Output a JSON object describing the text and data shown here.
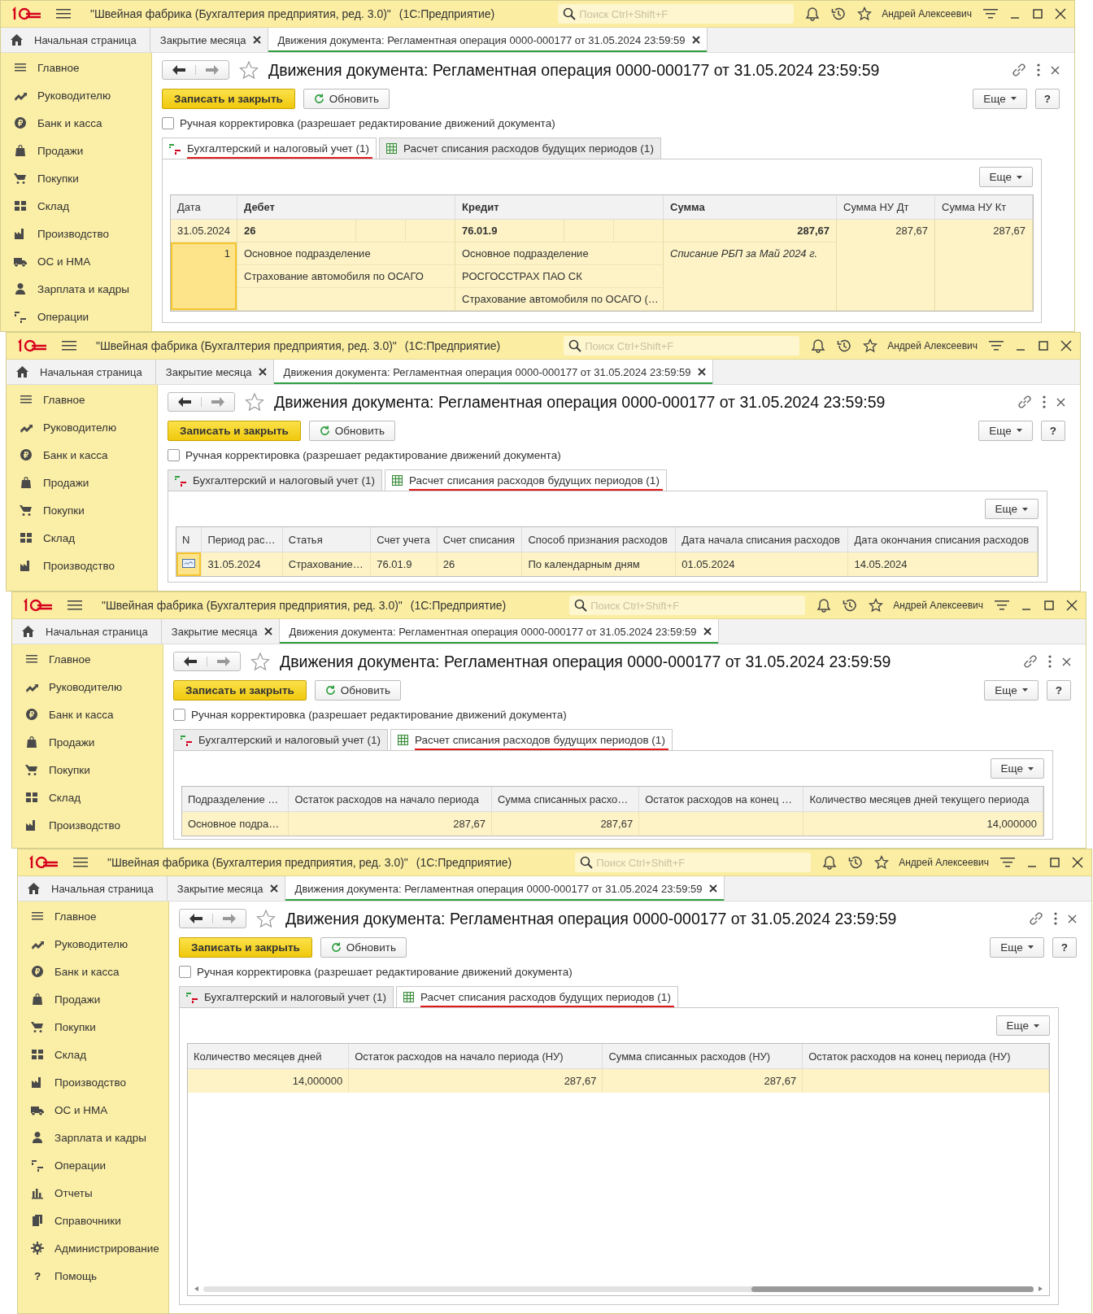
{
  "windows": [
    {
      "title": "\"Швейная фабрика (Бухгалтерия предприятия, ред. 3.0)\"",
      "app": "(1С:Предприятие)",
      "search_placeholder": "Поиск Ctrl+Shift+F",
      "user": "Андрей Алексеевич",
      "tabs": [
        {
          "label": "Начальная страница",
          "closable": false,
          "selected": false
        },
        {
          "label": "Закрытие месяца",
          "closable": true,
          "selected": false
        },
        {
          "label": "Движения документа: Регламентная операция 0000-000177 от 31.05.2024 23:59:59",
          "closable": true,
          "selected": true
        }
      ],
      "sidebar": [
        {
          "label": "Главное"
        },
        {
          "label": "Руководителю"
        },
        {
          "label": "Банк и касса"
        },
        {
          "label": "Продажи"
        },
        {
          "label": "Покупки"
        },
        {
          "label": "Склад"
        },
        {
          "label": "Производство"
        },
        {
          "label": "ОС и НМА"
        },
        {
          "label": "Зарплата и кадры"
        },
        {
          "label": "Операции"
        }
      ],
      "form": {
        "title": "Движения документа: Регламентная операция 0000-000177 от 31.05.2024 23:59:59",
        "save": "Записать и закрыть",
        "refresh": "Обновить",
        "more": "Еще",
        "help": "?",
        "manual": {
          "label": "Ручная корректировка (разрешает редактирование движений документа)",
          "checked": false
        },
        "tabs": [
          {
            "label": "Бухгалтерский и налоговый учет (1)",
            "selected": true
          },
          {
            "label": "Расчет списания расходов будущих периодов (1)",
            "selected": false
          }
        ],
        "panel_more": "Еще",
        "table": {
          "kind": "entries",
          "columns": [
            "Дата",
            "Дебет",
            "Кредит",
            "Сумма",
            "Сумма НУ Дт",
            "Сумма НУ Кт"
          ],
          "rows": [
            {
              "selected": true,
              "date": "31.05.2024",
              "number": "1",
              "debit": [
                "26",
                "Основное подразделение",
                "Страхование автомобиля по ОСАГО"
              ],
              "credit": [
                "76.01.9",
                "Основное подразделение",
                "РОСГОССТРАХ ПАО СК",
                "Страхование автомобиля по ОСАГО (…"
              ],
              "sum": "287,67",
              "content": "Списание РБП за Май 2024 г.",
              "sum_nu_dt": "287,67",
              "sum_nu_kt": "287,67"
            }
          ]
        }
      }
    },
    {
      "title": "\"Швейная фабрика (Бухгалтерия предприятия, ред. 3.0)\"",
      "app": "(1С:Предприятие)",
      "search_placeholder": "Поиск Ctrl+Shift+F",
      "user": "Андрей Алексеевич",
      "tabs": [
        {
          "label": "Начальная страница",
          "closable": false,
          "selected": false
        },
        {
          "label": "Закрытие месяца",
          "closable": true,
          "selected": false
        },
        {
          "label": "Движения документа: Регламентная операция 0000-000177 от 31.05.2024 23:59:59",
          "closable": true,
          "selected": true
        }
      ],
      "sidebar": [
        {
          "label": "Главное"
        },
        {
          "label": "Руководителю"
        },
        {
          "label": "Банк и касса"
        },
        {
          "label": "Продажи"
        },
        {
          "label": "Покупки"
        },
        {
          "label": "Склад"
        },
        {
          "label": "Производство"
        }
      ],
      "form": {
        "title": "Движения документа: Регламентная операция 0000-000177 от 31.05.2024 23:59:59",
        "save": "Записать и закрыть",
        "refresh": "Обновить",
        "more": "Еще",
        "help": "?",
        "manual": {
          "label": "Ручная корректировка (разрешает редактирование движений документа)",
          "checked": false
        },
        "tabs": [
          {
            "label": "Бухгалтерский и налоговый учет (1)",
            "selected": false
          },
          {
            "label": "Расчет списания расходов будущих периодов (1)",
            "selected": true
          }
        ],
        "panel_more": "Еще",
        "table": {
          "kind": "grid",
          "columns": [
            {
              "label": "N"
            },
            {
              "label": "Период рас…",
              "right_aligned": false
            },
            {
              "label": "Статья",
              "right_aligned": false
            },
            {
              "label": "Счет учета",
              "right_aligned": false
            },
            {
              "label": "Счет списания",
              "right_aligned": false
            },
            {
              "label": "Способ признания расходов",
              "right_aligned": false
            },
            {
              "label": "Дата начала списания расходов",
              "right_aligned": false
            },
            {
              "label": "Дата окончания списания расходов",
              "right_aligned": false
            }
          ],
          "rows": [
            {
              "selected": true,
              "cells": [
                {
                  "kind": "icon"
                },
                {
                  "text": "31.05.2024"
                },
                {
                  "text": "Страхование…"
                },
                {
                  "text": "76.01.9"
                },
                {
                  "text": "26"
                },
                {
                  "text": "По календарным дням"
                },
                {
                  "text": "01.05.2024"
                },
                {
                  "text": "14.05.2024"
                }
              ]
            }
          ]
        }
      }
    },
    {
      "title": "\"Швейная фабрика (Бухгалтерия предприятия, ред. 3.0)\"",
      "app": "(1С:Предприятие)",
      "search_placeholder": "Поиск Ctrl+Shift+F",
      "user": "Андрей Алексеевич",
      "tabs": [
        {
          "label": "Начальная страница",
          "closable": false,
          "selected": false
        },
        {
          "label": "Закрытие месяца",
          "closable": true,
          "selected": false
        },
        {
          "label": "Движения документа: Регламентная операция 0000-000177 от 31.05.2024 23:59:59",
          "closable": true,
          "selected": true
        }
      ],
      "sidebar": [
        {
          "label": "Главное"
        },
        {
          "label": "Руководителю"
        },
        {
          "label": "Банк и касса"
        },
        {
          "label": "Продажи"
        },
        {
          "label": "Покупки"
        },
        {
          "label": "Склад"
        },
        {
          "label": "Производство"
        }
      ],
      "form": {
        "title": "Движения документа: Регламентная операция 0000-000177 от 31.05.2024 23:59:59",
        "save": "Записать и закрыть",
        "refresh": "Обновить",
        "more": "Еще",
        "help": "?",
        "manual": {
          "label": "Ручная корректировка (разрешает редактирование движений документа)",
          "checked": false
        },
        "tabs": [
          {
            "label": "Бухгалтерский и налоговый учет (1)",
            "selected": false
          },
          {
            "label": "Расчет списания расходов будущих периодов (1)",
            "selected": true
          }
        ],
        "panel_more": "Еще",
        "table": {
          "kind": "grid",
          "columns": [
            {
              "label": "Подразделение …",
              "right_aligned": false
            },
            {
              "label": "Остаток расходов на начало периода",
              "right_aligned": true
            },
            {
              "label": "Сумма списанных расхо…",
              "right_aligned": true
            },
            {
              "label": "Остаток расходов на конец …"
            },
            {
              "label": "Количество месяцев дней текущего периода",
              "right_aligned": true
            }
          ],
          "rows": [
            {
              "selected": true,
              "cells": [
                {
                  "text": "Основное подра…"
                },
                {
                  "text": "287,67"
                },
                {
                  "text": "287,67"
                },
                null,
                {
                  "text": "14,000000"
                }
              ]
            }
          ]
        }
      }
    },
    {
      "title": "\"Швейная фабрика (Бухгалтерия предприятия, ред. 3.0)\"",
      "app": "(1С:Предприятие)",
      "search_placeholder": "Поиск Ctrl+Shift+F",
      "user": "Андрей Алексеевич",
      "tabs": [
        {
          "label": "Начальная страница",
          "closable": false,
          "selected": false
        },
        {
          "label": "Закрытие месяца",
          "closable": true,
          "selected": false
        },
        {
          "label": "Движения документа: Регламентная операция 0000-000177 от 31.05.2024 23:59:59",
          "closable": true,
          "selected": true
        }
      ],
      "sidebar": [
        {
          "label": "Главное"
        },
        {
          "label": "Руководителю"
        },
        {
          "label": "Банк и касса"
        },
        {
          "label": "Продажи"
        },
        {
          "label": "Покупки"
        },
        {
          "label": "Склад"
        },
        {
          "label": "Производство"
        },
        {
          "label": "ОС и НМА"
        },
        {
          "label": "Зарплата и кадры"
        },
        {
          "label": "Операции"
        },
        {
          "label": "Отчеты"
        },
        {
          "label": "Справочники"
        },
        {
          "label": "Администрирование"
        },
        {
          "label": "Помощь",
          "symbol": "?"
        }
      ],
      "form": {
        "title": "Движения документа: Регламентная операция 0000-000177 от 31.05.2024 23:59:59",
        "save": "Записать и закрыть",
        "refresh": "Обновить",
        "more": "Еще",
        "help": "?",
        "manual": {
          "label": "Ручная корректировка (разрешает редактирование движений документа)",
          "checked": false
        },
        "tabs": [
          {
            "label": "Бухгалтерский и налоговый учет (1)",
            "selected": false
          },
          {
            "label": "Расчет списания расходов будущих периодов (1)",
            "selected": true
          }
        ],
        "panel_more": "Еще",
        "table": {
          "kind": "grid",
          "scrollbar": true,
          "columns": [
            {
              "label": "Количество месяцев дней",
              "right_aligned": true
            },
            {
              "label": "Остаток расходов на начало периода (НУ)",
              "right_aligned": true
            },
            {
              "label": "Сумма списанных расходов (НУ)",
              "right_aligned": true
            },
            {
              "label": "Остаток расходов на конец периода (НУ)"
            }
          ],
          "rows": [
            {
              "selected": true,
              "cells": [
                {
                  "text": "14,000000"
                },
                {
                  "text": "287,67"
                },
                {
                  "text": "287,67"
                },
                null
              ]
            }
          ]
        }
      }
    }
  ]
}
